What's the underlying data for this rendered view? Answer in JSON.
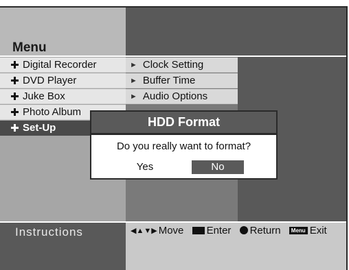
{
  "menu": {
    "title": "Menu"
  },
  "left_menu": {
    "items": [
      {
        "label": "Digital Recorder",
        "icon": "plus-icon"
      },
      {
        "label": "DVD Player",
        "icon": "plus-icon"
      },
      {
        "label": "Juke Box",
        "icon": "plus-icon"
      },
      {
        "label": "Photo Album",
        "icon": "plus-icon"
      },
      {
        "label": "Set-Up",
        "icon": "plus-icon",
        "selected": true
      }
    ]
  },
  "submenu": {
    "items": [
      {
        "label": "Clock Setting",
        "icon": "arrow-icon"
      },
      {
        "label": "Buffer Time",
        "icon": "arrow-icon"
      },
      {
        "label": "Audio Options",
        "icon": "arrow-icon"
      }
    ]
  },
  "dialog": {
    "title": "HDD Format",
    "message": "Do you really want to format?",
    "yes_label": "Yes",
    "no_label": "No",
    "selected": "No"
  },
  "instructions": {
    "title": "Instructions",
    "move": "Move",
    "enter": "Enter",
    "return": "Return",
    "menu_key": "Menu",
    "exit": "Exit"
  },
  "colors": {
    "selected_bg": "#4a4a4a",
    "dialog_header": "#5a5a5a",
    "dark_panel": "#595959"
  }
}
